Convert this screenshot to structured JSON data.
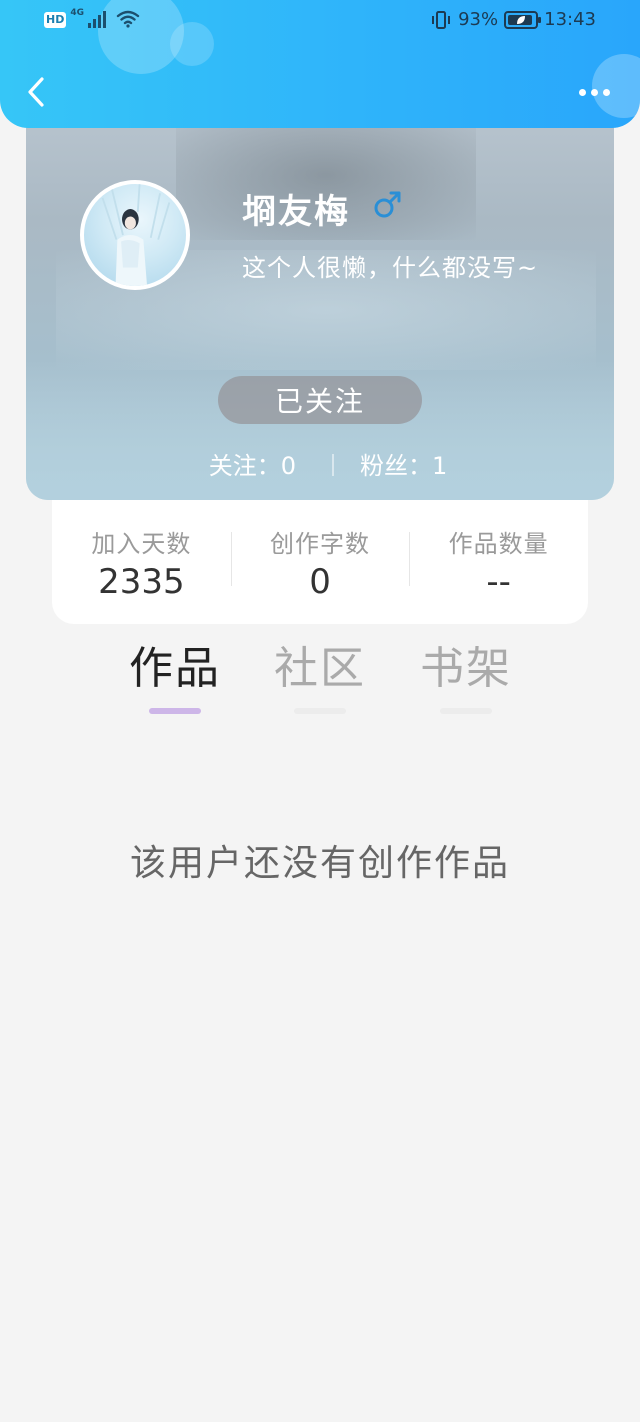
{
  "status_bar": {
    "hd": "HD",
    "network": "4G",
    "battery_level": "93%",
    "battery_fraction": 0.93,
    "time": "13:43"
  },
  "profile": {
    "name": "埛友梅",
    "gender_symbol": "♂",
    "bio": "这个人很懒，什么都没写~",
    "follow_button": "已关注",
    "following_label": "关注：",
    "following_count": "0",
    "fans_label": "粉丝：",
    "fans_count": "1"
  },
  "summary": [
    {
      "label": "加入天数",
      "value": "2335"
    },
    {
      "label": "创作字数",
      "value": "0"
    },
    {
      "label": "作品数量",
      "value": "--"
    }
  ],
  "tabs": [
    {
      "label": "作品",
      "active": true
    },
    {
      "label": "社区",
      "active": false
    },
    {
      "label": "书架",
      "active": false
    }
  ],
  "empty_message": "该用户还没有创作作品",
  "colors": {
    "header_gradient_start": "#36c6f7",
    "header_gradient_end": "#29a6fb",
    "gender_icon": "#2a8fd6",
    "tab_underline_active": "#cdb6e8",
    "background": "#f4f4f4"
  },
  "icons": {
    "back": "chevron-left-icon",
    "more": "more-dots-icon",
    "gender": "male-icon",
    "wifi": "wifi-icon",
    "signal": "signal-icon",
    "vibrate": "vibrate-icon",
    "battery": "battery-icon"
  }
}
